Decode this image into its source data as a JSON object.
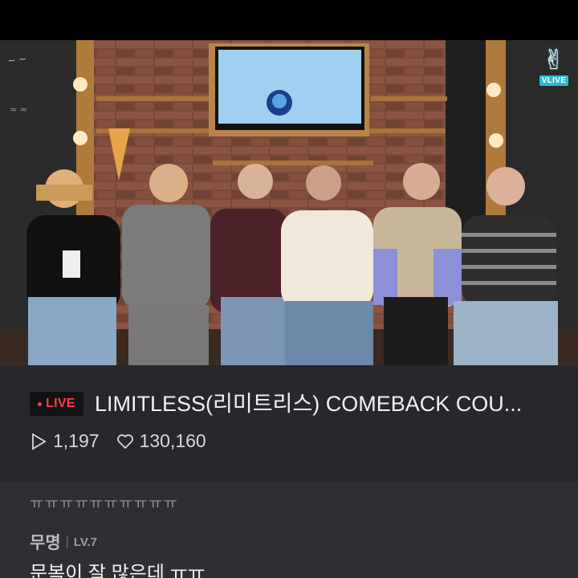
{
  "video": {
    "brand_badge_text": "VLIVE",
    "brand_icon": "vlive-v-icon"
  },
  "broadcast": {
    "live_label": "LIVE",
    "title": "LIMITLESS(리미트리스) COMEBACK COU...",
    "views_icon": "play-icon",
    "views": "1,197",
    "likes_icon": "heart-icon",
    "likes": "130,160"
  },
  "chat": {
    "messages": [
      {
        "text": "ㅠㅠㅠㅠㅠㅠㅠㅠㅠㅠ"
      },
      {
        "user": "무명",
        "level": "LV.7",
        "text": "문복이 잘 많은데 ㅠㅠ"
      }
    ]
  },
  "colors": {
    "live_red": "#ff3b47",
    "vlive_cyan": "#2fb9d3",
    "info_bg": "#26282c",
    "chat_bg": "#2d2f33"
  }
}
